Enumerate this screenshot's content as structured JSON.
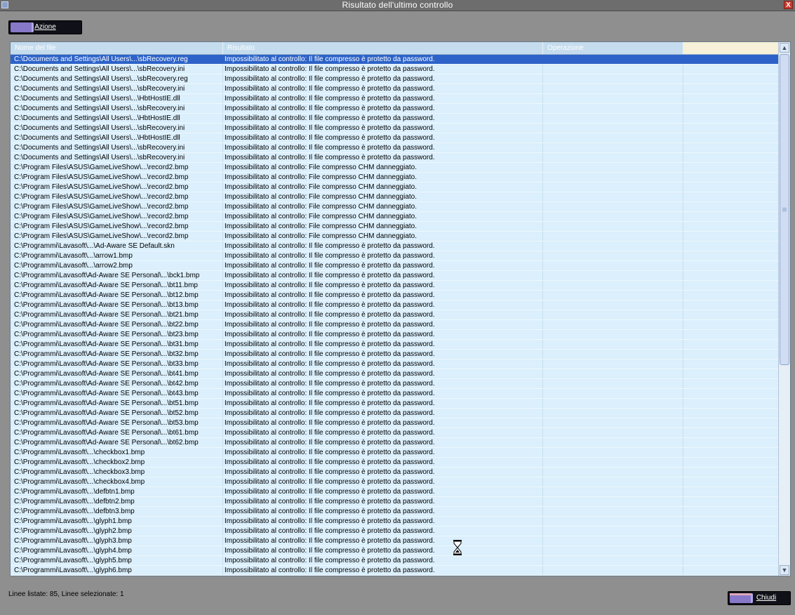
{
  "window": {
    "title": "Risultato dell'ultimo controllo",
    "close_label": "X"
  },
  "toolbar": {
    "action_label": "Azione"
  },
  "table": {
    "columns": [
      "Nome del file",
      "Risultato",
      "Operazione",
      ""
    ],
    "selected_index": 0,
    "rows": [
      [
        "C:\\Documents and Settings\\All Users\\...\\sbRecovery.reg",
        "Impossibilitato al controllo: Il file compresso è protetto da password."
      ],
      [
        "C:\\Documents and Settings\\All Users\\...\\sbRecovery.ini",
        "Impossibilitato al controllo: Il file compresso è protetto da password."
      ],
      [
        "C:\\Documents and Settings\\All Users\\...\\sbRecovery.reg",
        "Impossibilitato al controllo: Il file compresso è protetto da password."
      ],
      [
        "C:\\Documents and Settings\\All Users\\...\\sbRecovery.ini",
        "Impossibilitato al controllo: Il file compresso è protetto da password."
      ],
      [
        "C:\\Documents and Settings\\All Users\\...\\HbtHostIE.dll",
        "Impossibilitato al controllo: Il file compresso è protetto da password."
      ],
      [
        "C:\\Documents and Settings\\All Users\\...\\sbRecovery.ini",
        "Impossibilitato al controllo: Il file compresso è protetto da password."
      ],
      [
        "C:\\Documents and Settings\\All Users\\...\\HbtHostIE.dll",
        "Impossibilitato al controllo: Il file compresso è protetto da password."
      ],
      [
        "C:\\Documents and Settings\\All Users\\...\\sbRecovery.ini",
        "Impossibilitato al controllo: Il file compresso è protetto da password."
      ],
      [
        "C:\\Documents and Settings\\All Users\\...\\HbtHostIE.dll",
        "Impossibilitato al controllo: Il file compresso è protetto da password."
      ],
      [
        "C:\\Documents and Settings\\All Users\\...\\sbRecovery.ini",
        "Impossibilitato al controllo: Il file compresso è protetto da password."
      ],
      [
        "C:\\Documents and Settings\\All Users\\...\\sbRecovery.ini",
        "Impossibilitato al controllo: Il file compresso è protetto da password."
      ],
      [
        "C:\\Program Files\\ASUS\\GameLiveShow\\...\\record2.bmp",
        "Impossibilitato al controllo: File compresso CHM danneggiato."
      ],
      [
        "C:\\Program Files\\ASUS\\GameLiveShow\\...\\record2.bmp",
        "Impossibilitato al controllo: File compresso CHM danneggiato."
      ],
      [
        "C:\\Program Files\\ASUS\\GameLiveShow\\...\\record2.bmp",
        "Impossibilitato al controllo: File compresso CHM danneggiato."
      ],
      [
        "C:\\Program Files\\ASUS\\GameLiveShow\\...\\record2.bmp",
        "Impossibilitato al controllo: File compresso CHM danneggiato."
      ],
      [
        "C:\\Program Files\\ASUS\\GameLiveShow\\...\\record2.bmp",
        "Impossibilitato al controllo: File compresso CHM danneggiato."
      ],
      [
        "C:\\Program Files\\ASUS\\GameLiveShow\\...\\record2.bmp",
        "Impossibilitato al controllo: File compresso CHM danneggiato."
      ],
      [
        "C:\\Program Files\\ASUS\\GameLiveShow\\...\\record2.bmp",
        "Impossibilitato al controllo: File compresso CHM danneggiato."
      ],
      [
        "C:\\Program Files\\ASUS\\GameLiveShow\\...\\record2.bmp",
        "Impossibilitato al controllo: File compresso CHM danneggiato."
      ],
      [
        "C:\\Programmi\\Lavasoft\\...\\Ad-Aware SE Default.skn",
        "Impossibilitato al controllo: Il file compresso è protetto da password."
      ],
      [
        "C:\\Programmi\\Lavasoft\\...\\arrow1.bmp",
        "Impossibilitato al controllo: Il file compresso è protetto da password."
      ],
      [
        "C:\\Programmi\\Lavasoft\\...\\arrow2.bmp",
        "Impossibilitato al controllo: Il file compresso è protetto da password."
      ],
      [
        "C:\\Programmi\\Lavasoft\\Ad-Aware SE Personal\\...\\bck1.bmp",
        "Impossibilitato al controllo: Il file compresso è protetto da password."
      ],
      [
        "C:\\Programmi\\Lavasoft\\Ad-Aware SE Personal\\...\\bt11.bmp",
        "Impossibilitato al controllo: Il file compresso è protetto da password."
      ],
      [
        "C:\\Programmi\\Lavasoft\\Ad-Aware SE Personal\\...\\bt12.bmp",
        "Impossibilitato al controllo: Il file compresso è protetto da password."
      ],
      [
        "C:\\Programmi\\Lavasoft\\Ad-Aware SE Personal\\...\\bt13.bmp",
        "Impossibilitato al controllo: Il file compresso è protetto da password."
      ],
      [
        "C:\\Programmi\\Lavasoft\\Ad-Aware SE Personal\\...\\bt21.bmp",
        "Impossibilitato al controllo: Il file compresso è protetto da password."
      ],
      [
        "C:\\Programmi\\Lavasoft\\Ad-Aware SE Personal\\...\\bt22.bmp",
        "Impossibilitato al controllo: Il file compresso è protetto da password."
      ],
      [
        "C:\\Programmi\\Lavasoft\\Ad-Aware SE Personal\\...\\bt23.bmp",
        "Impossibilitato al controllo: Il file compresso è protetto da password."
      ],
      [
        "C:\\Programmi\\Lavasoft\\Ad-Aware SE Personal\\...\\bt31.bmp",
        "Impossibilitato al controllo: Il file compresso è protetto da password."
      ],
      [
        "C:\\Programmi\\Lavasoft\\Ad-Aware SE Personal\\...\\bt32.bmp",
        "Impossibilitato al controllo: Il file compresso è protetto da password."
      ],
      [
        "C:\\Programmi\\Lavasoft\\Ad-Aware SE Personal\\...\\bt33.bmp",
        "Impossibilitato al controllo: Il file compresso è protetto da password."
      ],
      [
        "C:\\Programmi\\Lavasoft\\Ad-Aware SE Personal\\...\\bt41.bmp",
        "Impossibilitato al controllo: Il file compresso è protetto da password."
      ],
      [
        "C:\\Programmi\\Lavasoft\\Ad-Aware SE Personal\\...\\bt42.bmp",
        "Impossibilitato al controllo: Il file compresso è protetto da password."
      ],
      [
        "C:\\Programmi\\Lavasoft\\Ad-Aware SE Personal\\...\\bt43.bmp",
        "Impossibilitato al controllo: Il file compresso è protetto da password."
      ],
      [
        "C:\\Programmi\\Lavasoft\\Ad-Aware SE Personal\\...\\bt51.bmp",
        "Impossibilitato al controllo: Il file compresso è protetto da password."
      ],
      [
        "C:\\Programmi\\Lavasoft\\Ad-Aware SE Personal\\...\\bt52.bmp",
        "Impossibilitato al controllo: Il file compresso è protetto da password."
      ],
      [
        "C:\\Programmi\\Lavasoft\\Ad-Aware SE Personal\\...\\bt53.bmp",
        "Impossibilitato al controllo: Il file compresso è protetto da password."
      ],
      [
        "C:\\Programmi\\Lavasoft\\Ad-Aware SE Personal\\...\\bt61.bmp",
        "Impossibilitato al controllo: Il file compresso è protetto da password."
      ],
      [
        "C:\\Programmi\\Lavasoft\\Ad-Aware SE Personal\\...\\bt62.bmp",
        "Impossibilitato al controllo: Il file compresso è protetto da password."
      ],
      [
        "C:\\Programmi\\Lavasoft\\...\\checkbox1.bmp",
        "Impossibilitato al controllo: Il file compresso è protetto da password."
      ],
      [
        "C:\\Programmi\\Lavasoft\\...\\checkbox2.bmp",
        "Impossibilitato al controllo: Il file compresso è protetto da password."
      ],
      [
        "C:\\Programmi\\Lavasoft\\...\\checkbox3.bmp",
        "Impossibilitato al controllo: Il file compresso è protetto da password."
      ],
      [
        "C:\\Programmi\\Lavasoft\\...\\checkbox4.bmp",
        "Impossibilitato al controllo: Il file compresso è protetto da password."
      ],
      [
        "C:\\Programmi\\Lavasoft\\...\\defbtn1.bmp",
        "Impossibilitato al controllo: Il file compresso è protetto da password."
      ],
      [
        "C:\\Programmi\\Lavasoft\\...\\defbtn2.bmp",
        "Impossibilitato al controllo: Il file compresso è protetto da password."
      ],
      [
        "C:\\Programmi\\Lavasoft\\...\\defbtn3.bmp",
        "Impossibilitato al controllo: Il file compresso è protetto da password."
      ],
      [
        "C:\\Programmi\\Lavasoft\\...\\glyph1.bmp",
        "Impossibilitato al controllo: Il file compresso è protetto da password."
      ],
      [
        "C:\\Programmi\\Lavasoft\\...\\glyph2.bmp",
        "Impossibilitato al controllo: Il file compresso è protetto da password."
      ],
      [
        "C:\\Programmi\\Lavasoft\\...\\glyph3.bmp",
        "Impossibilitato al controllo: Il file compresso è protetto da password."
      ],
      [
        "C:\\Programmi\\Lavasoft\\...\\glyph4.bmp",
        "Impossibilitato al controllo: Il file compresso è protetto da password."
      ],
      [
        "C:\\Programmi\\Lavasoft\\...\\glyph5.bmp",
        "Impossibilitato al controllo: Il file compresso è protetto da password."
      ],
      [
        "C:\\Programmi\\Lavasoft\\...\\glyph6.bmp",
        "Impossibilitato al controllo: Il file compresso è protetto da password."
      ]
    ]
  },
  "status": {
    "text": "Linee listate: 85,  Linee selezionate: 1"
  },
  "footer": {
    "close_label": "Chiudi"
  },
  "icons": {
    "cursor": "hourglass-icon",
    "scroll_up": "arrow-up-icon",
    "scroll_down": "arrow-down-icon"
  },
  "colors": {
    "selection": "#2d63c8",
    "list_background": "#dbeffc",
    "window_background": "#8f8f8f"
  }
}
